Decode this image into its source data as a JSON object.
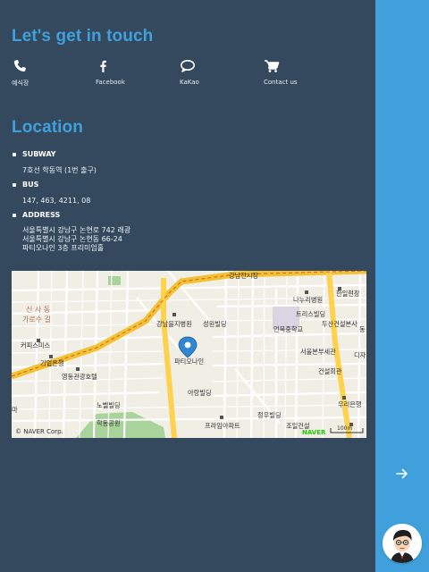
{
  "contact": {
    "heading": "Let's get in touch",
    "items": [
      {
        "label": "예식장",
        "icon": "phone-icon"
      },
      {
        "label": "Facebook",
        "icon": "facebook-icon"
      },
      {
        "label": "KaKao",
        "icon": "chat-bubble-icon"
      },
      {
        "label": "Contact us",
        "icon": "shopping-cart-icon"
      }
    ]
  },
  "location": {
    "heading": "Location",
    "subway": {
      "title": "SUBWAY",
      "value": "7호선 학동역 (1번 출구)"
    },
    "bus": {
      "title": "BUS",
      "value": "147, 463, 4211, 08"
    },
    "address": {
      "title": "ADDRESS",
      "lines": [
        "서울특별시 강남구 논현로 742 래광",
        "서울특별시 강남구 논현동 66-24",
        "파티오나인 3층 프리미엄홀"
      ]
    }
  },
  "map": {
    "labels": {
      "gangnam_jeonsijang": "강남전시장",
      "naneuri_hospital": "나누리병원",
      "hanilhyeon": "한일현창",
      "sinsadong": "신 사 동",
      "garosu": "가로수 길",
      "gangnam_eulji": "강남을지병원",
      "seongwon": "성원빌딩",
      "eonbuk_middle": "언북중학교",
      "trius": "트리스빌딩",
      "dusan": "두산건설본사",
      "coffee": "커피스미스",
      "patio_nine": "파티오나인",
      "gieop_bank": "기업은행",
      "seoul_headquarters": "서울본부세관",
      "geonseol_hall": "건설회관",
      "yeongdong_hotel": "영동관광호텔",
      "arang": "아랑빌딩",
      "nobel": "노벨빌딩",
      "woori_bank": "우리은행",
      "hakdong_park": "학동공원",
      "jeongwoo": "정우빌딩",
      "primiere": "프라임아파트",
      "joil": "조일건설",
      "copyright": "© NAVER Corp.",
      "naver": "NAVER",
      "scale": "100m",
      "ma": "마",
      "disa": "디자",
      "dong": "동"
    },
    "colors": {
      "land": "#f1eee6",
      "road": "#ffffff",
      "major_road": "#ffd24d",
      "park": "#a8d39a",
      "marker": "#2f86d1"
    }
  },
  "sidebar": {
    "arrow_icon": "arrow-right-icon",
    "avatar_icon": "avatar-cartoon-icon",
    "color": "#3fa0dc"
  }
}
